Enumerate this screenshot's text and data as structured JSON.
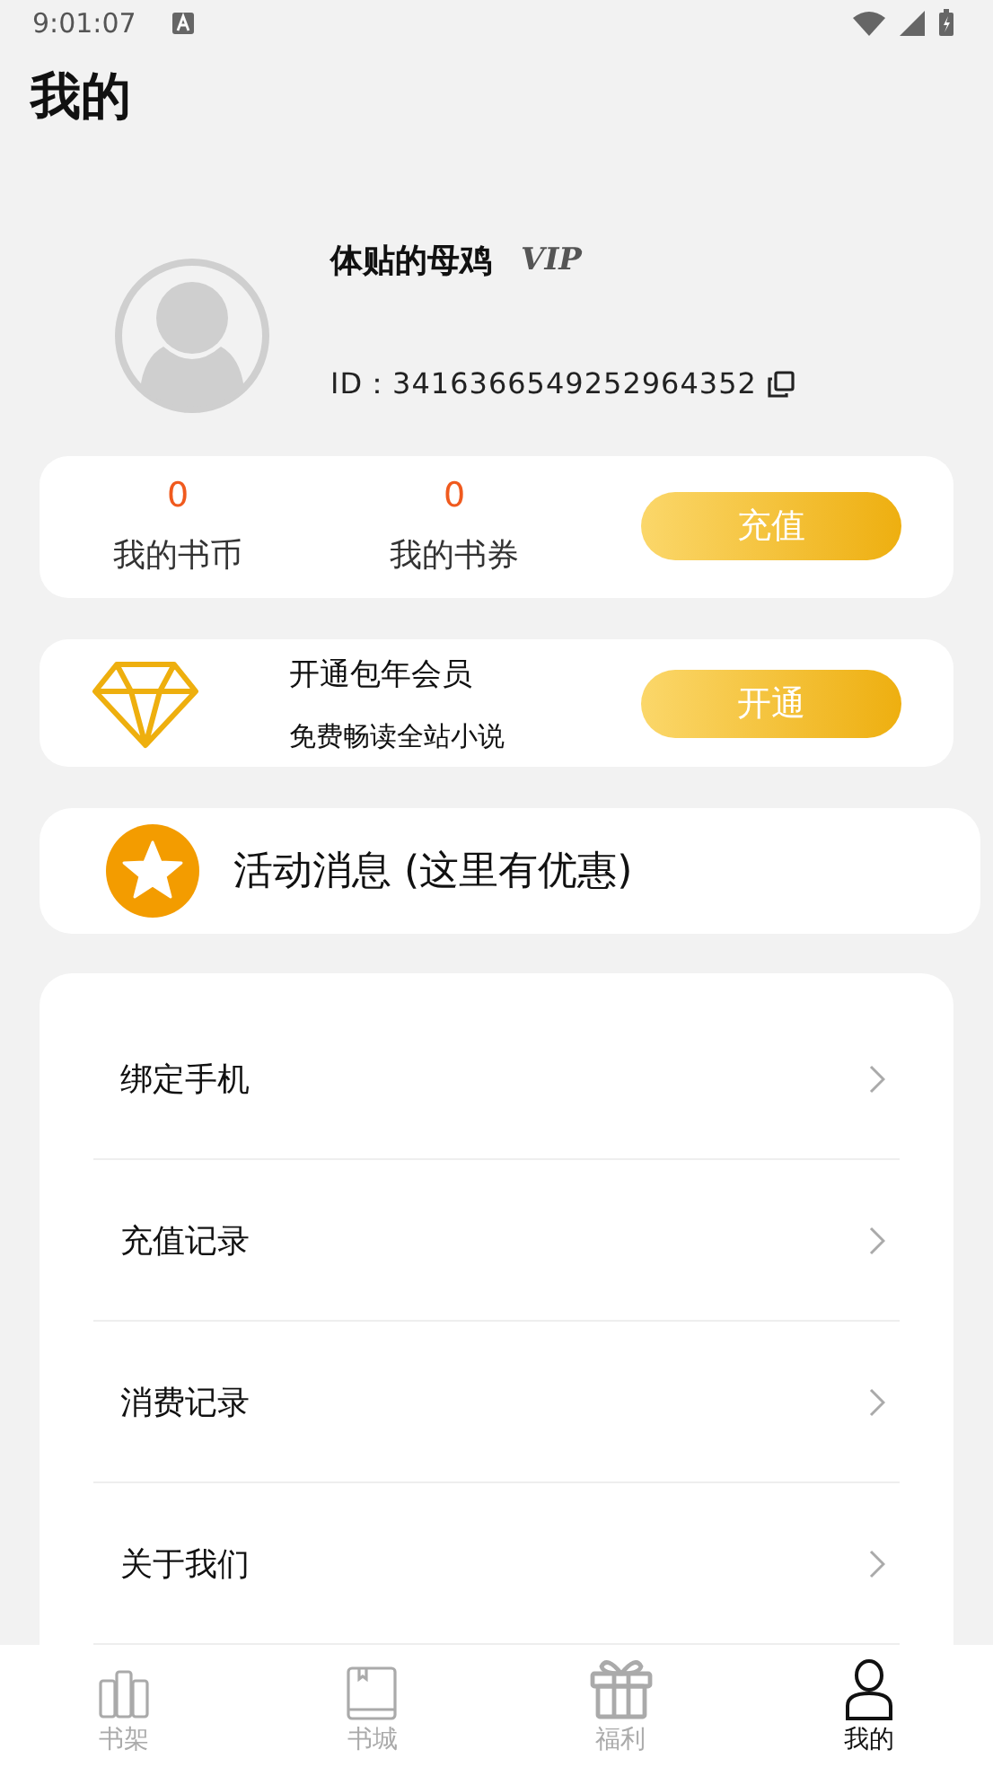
{
  "status_bar": {
    "time": "9:01:07"
  },
  "title": "我的",
  "profile": {
    "name": "体贴的母鸡",
    "badge": "VIP",
    "id": "ID：3416366549252964352"
  },
  "wallet": {
    "stats": [
      {
        "value": "0",
        "label": "我的书币"
      },
      {
        "value": "0",
        "label": "我的书券"
      }
    ],
    "button": "充值"
  },
  "membership": {
    "title": "开通包年会员",
    "subtitle": "免费畅读全站小说",
    "button": "开通"
  },
  "promo": {
    "label": "活动消息 (这里有优惠)"
  },
  "menu": [
    {
      "label": "绑定手机"
    },
    {
      "label": "充值记录"
    },
    {
      "label": "消费记录"
    },
    {
      "label": "关于我们"
    }
  ],
  "tabs": [
    {
      "label": "书架",
      "kind": "shelf",
      "selected": false
    },
    {
      "label": "书城",
      "kind": "book",
      "selected": false
    },
    {
      "label": "福利",
      "kind": "gift",
      "selected": false
    },
    {
      "label": "我的",
      "kind": "person",
      "selected": true
    }
  ]
}
